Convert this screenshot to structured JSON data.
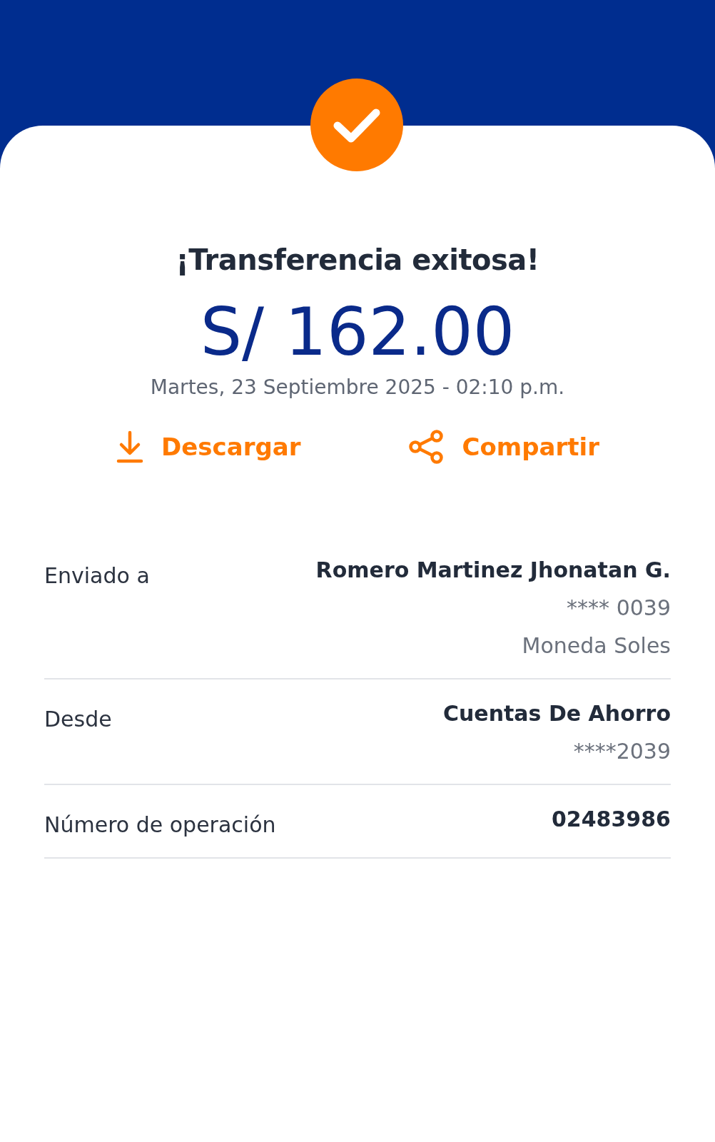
{
  "title": "¡Transferencia exitosa!",
  "amount": "S/ 162.00",
  "date": "Martes, 23 Septiembre 2025 - 02:10 p.m.",
  "actions": [
    {
      "kind": "download",
      "label": "Descargar"
    },
    {
      "kind": "share",
      "label": "Compartir"
    }
  ],
  "details": [
    {
      "label": "Enviado a",
      "values": [
        "Romero Martinez Jhonatan G.",
        "**** 0039",
        "Moneda Soles"
      ]
    },
    {
      "label": "Desde",
      "values": [
        "Cuentas De Ahorro",
        "****2039"
      ]
    },
    {
      "label": "Número de operación",
      "values": [
        "02483986"
      ]
    }
  ]
}
